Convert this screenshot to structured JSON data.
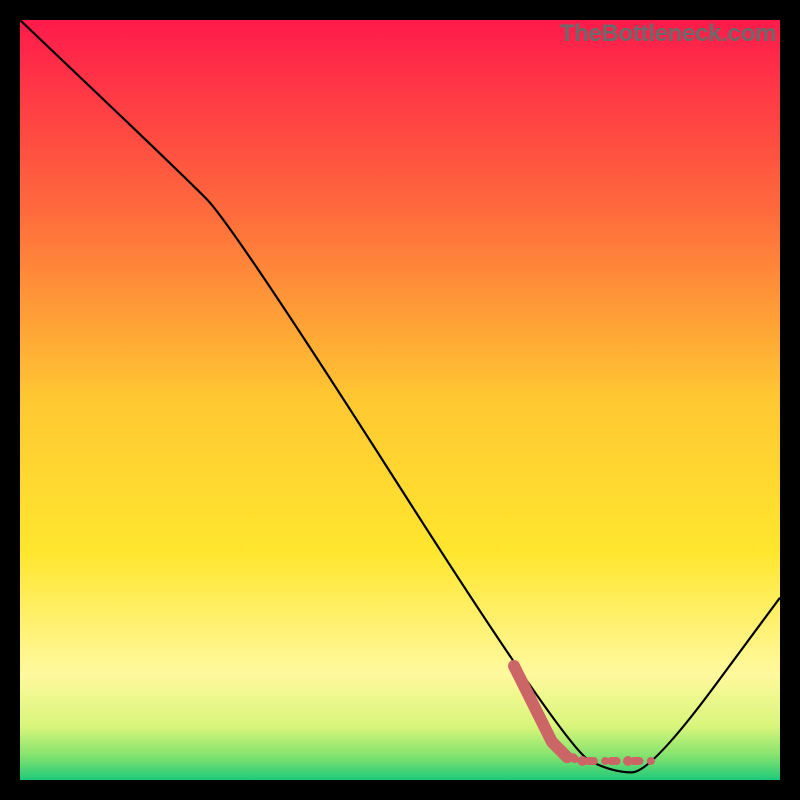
{
  "watermark": "TheBottleneck.com",
  "chart_data": {
    "type": "line",
    "title": "",
    "xlabel": "",
    "ylabel": "",
    "xlim": [
      0,
      100
    ],
    "ylim": [
      0,
      100
    ],
    "gradient_stops": [
      {
        "offset": 0,
        "color": "#ff1a4b"
      },
      {
        "offset": 0.25,
        "color": "#ff6a3c"
      },
      {
        "offset": 0.5,
        "color": "#ffc832"
      },
      {
        "offset": 0.7,
        "color": "#ffe62e"
      },
      {
        "offset": 0.86,
        "color": "#fff99e"
      },
      {
        "offset": 0.93,
        "color": "#d8f57a"
      },
      {
        "offset": 0.97,
        "color": "#7ee26e"
      },
      {
        "offset": 1.0,
        "color": "#1fc97a"
      }
    ],
    "series": [
      {
        "name": "bottleneck-curve",
        "stroke": "#000000",
        "points": [
          {
            "x": 0,
            "y": 100
          },
          {
            "x": 21,
            "y": 80
          },
          {
            "x": 28,
            "y": 73
          },
          {
            "x": 72,
            "y": 4
          },
          {
            "x": 78,
            "y": 1
          },
          {
            "x": 83,
            "y": 1
          },
          {
            "x": 100,
            "y": 24
          }
        ]
      },
      {
        "name": "optimal-marker",
        "stroke": "#cc6666",
        "style": "dotted-thick",
        "points": [
          {
            "x": 65,
            "y": 15
          },
          {
            "x": 68,
            "y": 9
          },
          {
            "x": 70,
            "y": 5
          },
          {
            "x": 72,
            "y": 3
          },
          {
            "x": 74,
            "y": 2.5
          },
          {
            "x": 77,
            "y": 2.5
          },
          {
            "x": 80,
            "y": 2.5
          },
          {
            "x": 83,
            "y": 2.5
          }
        ]
      }
    ]
  }
}
